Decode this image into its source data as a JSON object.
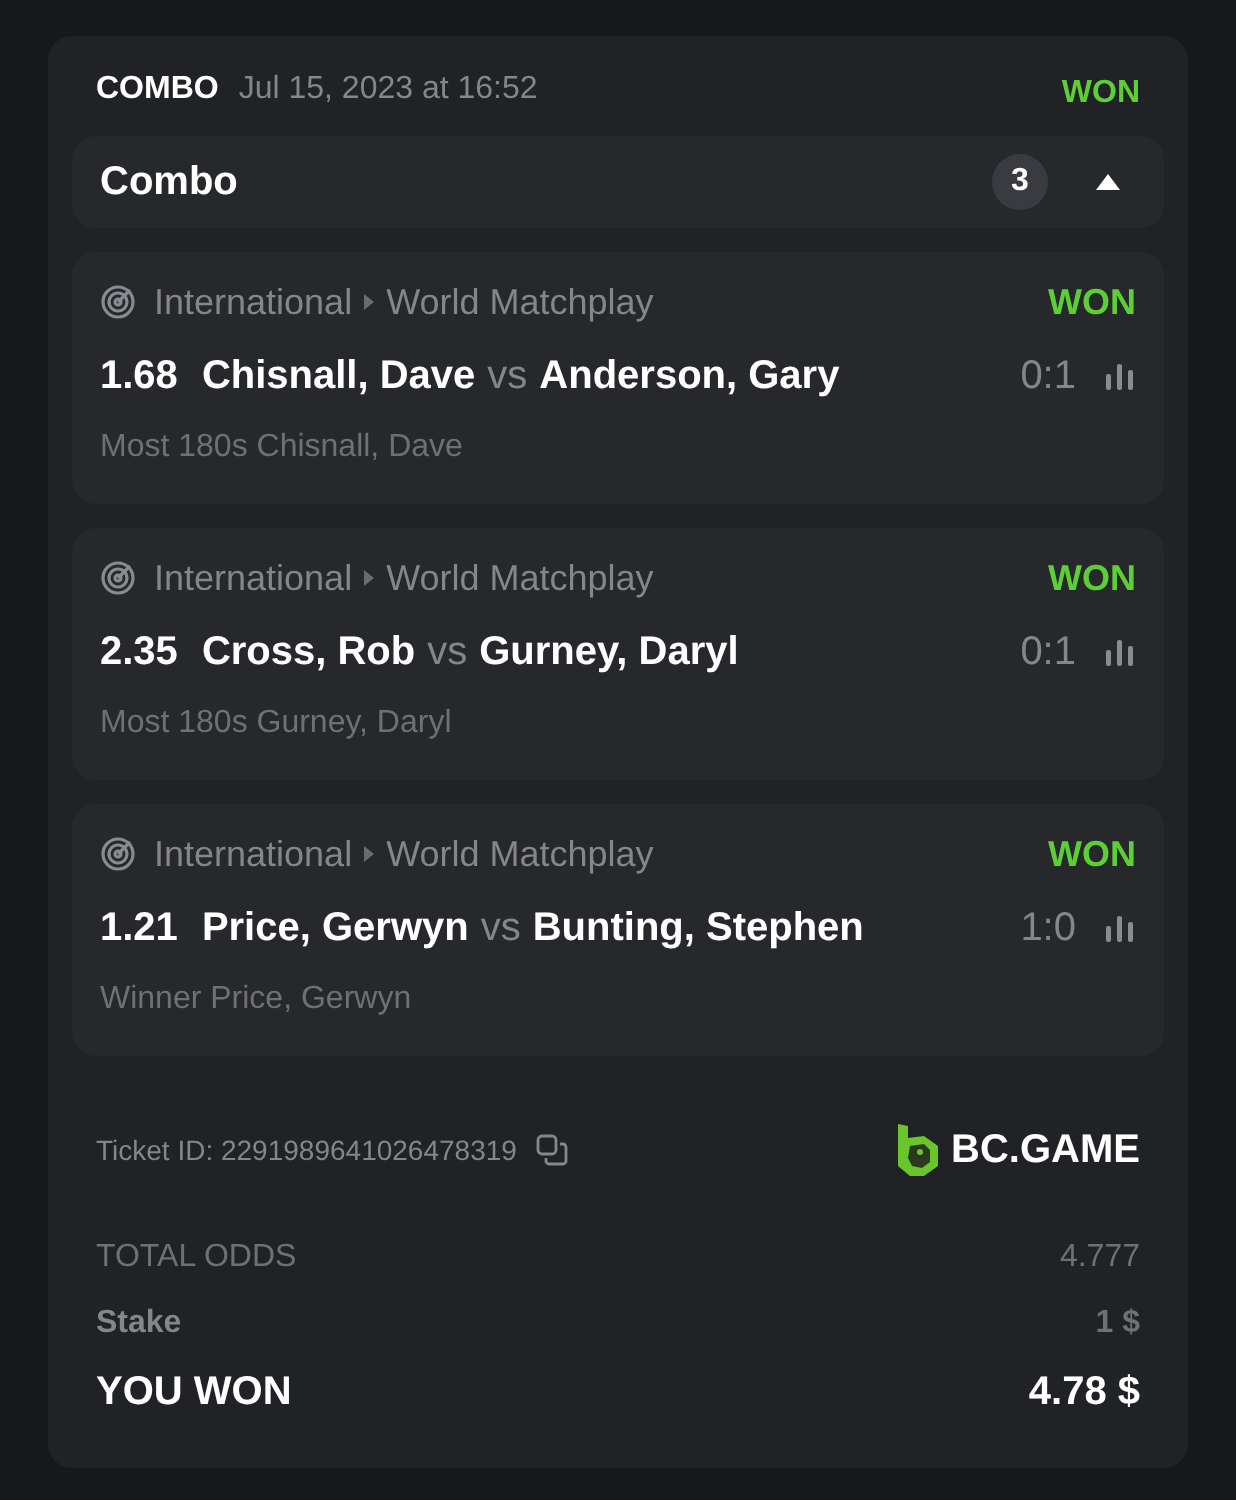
{
  "header": {
    "type": "COMBO",
    "date": "Jul 15, 2023 at 16:52",
    "status": "WON"
  },
  "combo": {
    "title": "Combo",
    "count": "3",
    "expanded": true
  },
  "legs": [
    {
      "category": "International",
      "tournament": "World Matchplay",
      "status": "WON",
      "odds": "1.68",
      "home": "Chisnall, Dave",
      "vs": "vs",
      "away": "Anderson, Gary",
      "score": "0:1",
      "market": "Most 180s Chisnall, Dave"
    },
    {
      "category": "International",
      "tournament": "World Matchplay",
      "status": "WON",
      "odds": "2.35",
      "home": "Cross, Rob",
      "vs": "vs",
      "away": "Gurney, Daryl",
      "score": "0:1",
      "market": "Most 180s Gurney, Daryl"
    },
    {
      "category": "International",
      "tournament": "World Matchplay",
      "status": "WON",
      "odds": "1.21",
      "home": "Price, Gerwyn",
      "vs": "vs",
      "away": "Bunting, Stephen",
      "score": "1:0",
      "market": "Winner Price, Gerwyn"
    }
  ],
  "ticket": {
    "label": "Ticket ID: 2291989641026478319",
    "brand": "BC.GAME"
  },
  "totals": [
    {
      "kind": "muted",
      "label": "TOTAL ODDS",
      "value": "4.777"
    },
    {
      "kind": "stake",
      "label": "Stake",
      "value": "1 $"
    },
    {
      "kind": "result",
      "label": "YOU WON",
      "value": "4.78 $"
    }
  ]
}
